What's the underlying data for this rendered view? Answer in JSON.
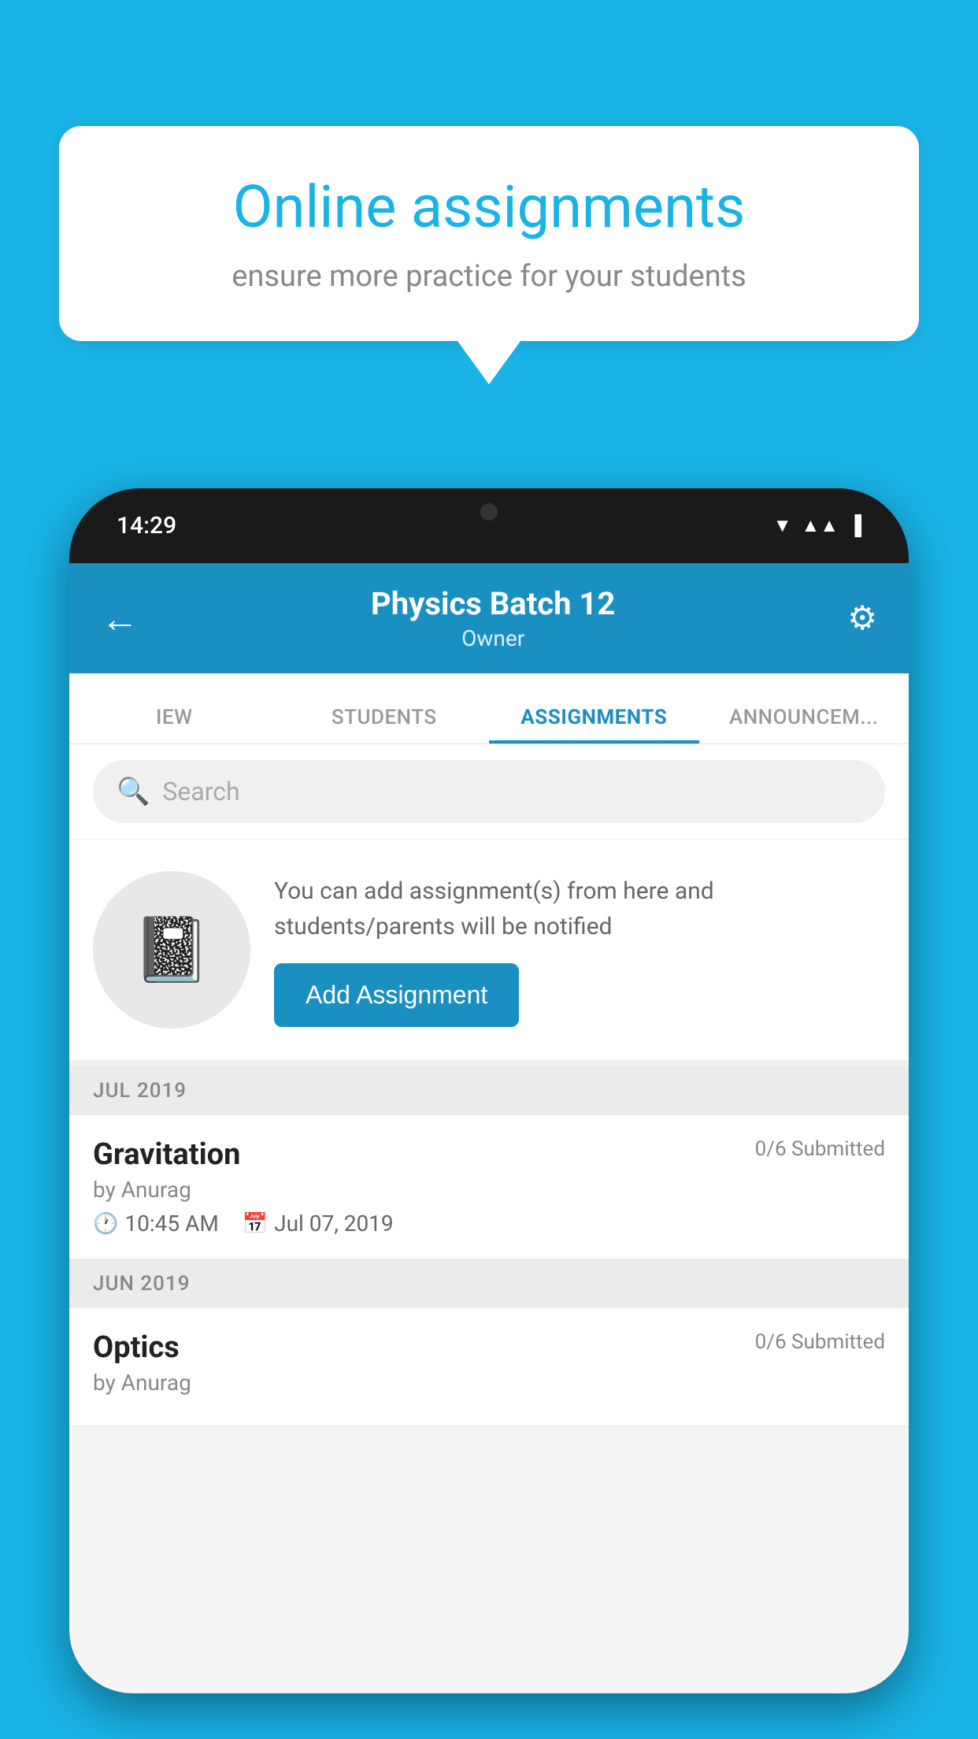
{
  "background_color": "#19b3e6",
  "speech_bubble": {
    "title": "Online assignments",
    "subtitle": "ensure more practice for your students"
  },
  "status_bar": {
    "time": "14:29",
    "icons": [
      "wifi",
      "signal",
      "battery"
    ]
  },
  "header": {
    "title": "Physics Batch 12",
    "subtitle": "Owner",
    "back_label": "←",
    "settings_label": "⚙"
  },
  "tabs": [
    {
      "label": "IEW",
      "active": false
    },
    {
      "label": "STUDENTS",
      "active": false
    },
    {
      "label": "ASSIGNMENTS",
      "active": true
    },
    {
      "label": "ANNOUNCEM...",
      "active": false
    }
  ],
  "search": {
    "placeholder": "Search"
  },
  "empty_state": {
    "description": "You can add assignment(s) from here and students/parents will be notified",
    "button_label": "Add Assignment"
  },
  "sections": [
    {
      "header": "JUL 2019",
      "assignments": [
        {
          "name": "Gravitation",
          "submitted": "0/6 Submitted",
          "author": "by Anurag",
          "time": "10:45 AM",
          "date": "Jul 07, 2019"
        }
      ]
    },
    {
      "header": "JUN 2019",
      "assignments": [
        {
          "name": "Optics",
          "submitted": "0/6 Submitted",
          "author": "by Anurag",
          "time": "",
          "date": ""
        }
      ]
    }
  ]
}
